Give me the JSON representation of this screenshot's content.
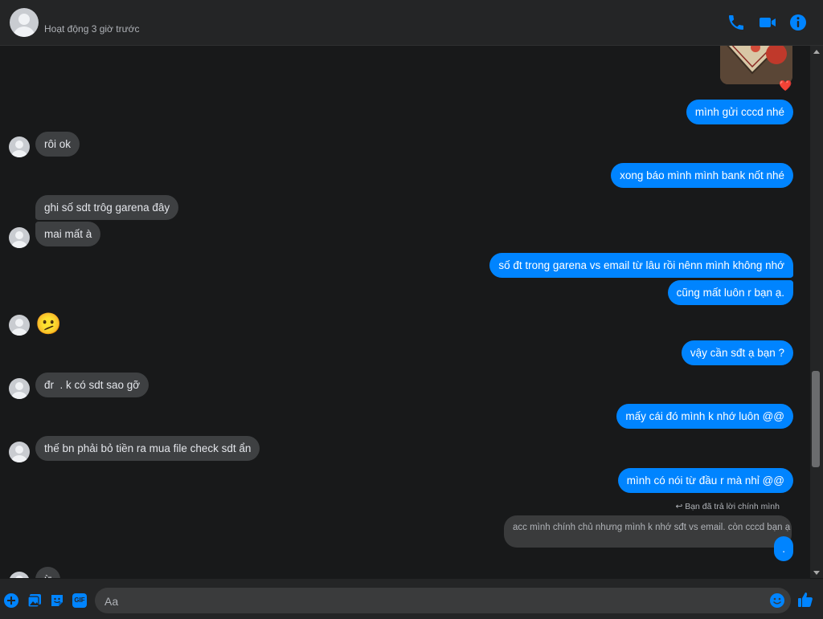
{
  "header": {
    "status": "Hoạt động 3 giờ trước",
    "icons": {
      "call": "phone-icon",
      "video": "video-camera-icon",
      "info": "info-icon"
    },
    "accent": "#0084ff"
  },
  "messages": {
    "m1": "mình gửi cccd nhé",
    "m2": "rôi ok",
    "m3": "xong báo mình mình bank nốt nhé",
    "m4": "ghi số sdt trôg garena đây",
    "m5": "mai mất à",
    "m6": "số đt trong garena vs email từ lâu rồi nênn mình không nhớ",
    "m7": "cũng mất luôn r bạn ạ.",
    "m8": "🫤",
    "m9": "vậy cần sđt ạ bạn ?",
    "m10": "đr  . k có sdt sao gỡ",
    "m11": "mấy cái đó mình k nhớ luôn @@",
    "m12": "thế bn phải bỏ tiền ra mua file check sdt ẩn",
    "m13": "mình có nói từ đầu r mà nhỉ @@",
    "reply_note": "Bạn đã trả lời chính mình",
    "reply_quote": "acc mình chính chủ nhưng mình k nhớ sđt vs email. còn cccd bạn ạ",
    "m14": ".",
    "partial": "ừ"
  },
  "reaction": "❤️",
  "composer": {
    "placeholder": "Aa",
    "icons": [
      "plus-icon",
      "image-icon",
      "sticker-icon",
      "gif-icon",
      "emoji-icon",
      "like-icon"
    ],
    "gif_label": "GIF"
  },
  "colors": {
    "outgoing": "#0084ff",
    "incoming": "#3e4042",
    "background": "#18191a"
  }
}
